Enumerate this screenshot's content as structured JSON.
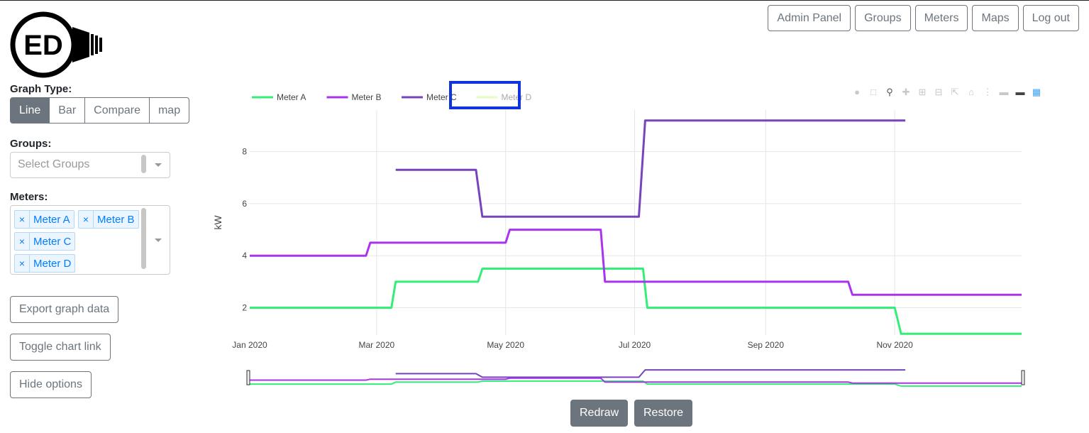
{
  "logo": {
    "text": "ED"
  },
  "nav": {
    "admin": "Admin Panel",
    "groups": "Groups",
    "meters": "Meters",
    "maps": "Maps",
    "logout": "Log out"
  },
  "options": {
    "graph_type_label": "Graph Type:",
    "graph_types": [
      "Line",
      "Bar",
      "Compare",
      "map"
    ],
    "active_graph_type": "Line",
    "groups_label": "Groups:",
    "groups_placeholder": "Select Groups",
    "meters_label": "Meters:",
    "selected_meters": [
      "Meter A",
      "Meter B",
      "Meter C",
      "Meter D"
    ],
    "chip_remove": "×",
    "export": "Export graph data",
    "toggle_link": "Toggle chart link",
    "hide": "Hide options"
  },
  "footer": {
    "redraw": "Redraw",
    "restore": "Restore"
  },
  "modebar_icons": [
    "camera-icon",
    "save-icon",
    "zoom-icon",
    "pan-icon",
    "zoom-in-icon",
    "zoom-out-icon",
    "autoscale-icon",
    "reset-axes-icon",
    "spike-lines-icon",
    "hover-closest-icon",
    "hover-compare-icon",
    "plotly-logo-icon"
  ],
  "chart_data": {
    "type": "line",
    "ylabel": "kW",
    "xlabel": "",
    "ylim": [
      0.95,
      9.6
    ],
    "xlim": [
      "2020-01-01",
      "2020-12-31"
    ],
    "y_ticks": [
      "2",
      "4",
      "6",
      "8"
    ],
    "x_ticks": [
      {
        "date": "2020-01-01",
        "label": "Jan 2020"
      },
      {
        "date": "2020-03-01",
        "label": "Mar 2020"
      },
      {
        "date": "2020-05-01",
        "label": "May 2020"
      },
      {
        "date": "2020-07-01",
        "label": "Jul 2020"
      },
      {
        "date": "2020-09-01",
        "label": "Sep 2020"
      },
      {
        "date": "2020-11-01",
        "label": "Nov 2020"
      }
    ],
    "grid": true,
    "legend_position": "top-left",
    "range_slider": true,
    "series": [
      {
        "name": "Meter A",
        "color": "#33ee77",
        "hidden": false,
        "points": [
          [
            "2020-01-01",
            2
          ],
          [
            "2020-03-08",
            2
          ],
          [
            "2020-03-10",
            3
          ],
          [
            "2020-04-18",
            3
          ],
          [
            "2020-04-20",
            3.5
          ],
          [
            "2020-07-05",
            3.5
          ],
          [
            "2020-07-07",
            2
          ],
          [
            "2020-11-01",
            2
          ],
          [
            "2020-11-04",
            1
          ],
          [
            "2020-12-31",
            1
          ]
        ]
      },
      {
        "name": "Meter B",
        "color": "#aa33ee",
        "hidden": false,
        "points": [
          [
            "2020-01-01",
            4
          ],
          [
            "2020-02-25",
            4
          ],
          [
            "2020-02-27",
            4.5
          ],
          [
            "2020-05-01",
            4.5
          ],
          [
            "2020-05-03",
            5
          ],
          [
            "2020-06-15",
            5
          ],
          [
            "2020-06-17",
            3
          ],
          [
            "2020-10-10",
            3
          ],
          [
            "2020-10-12",
            2.5
          ],
          [
            "2020-12-31",
            2.5
          ]
        ]
      },
      {
        "name": "Meter C",
        "color": "#7744bb",
        "hidden": false,
        "points": [
          [
            "2020-03-10",
            7.3
          ],
          [
            "2020-04-17",
            7.3
          ],
          [
            "2020-04-20",
            5.5
          ],
          [
            "2020-07-03",
            5.5
          ],
          [
            "2020-07-06",
            9.2
          ],
          [
            "2020-11-06",
            9.2
          ]
        ]
      },
      {
        "name": "Meter D",
        "color": "#ccff99",
        "hidden": true,
        "points": []
      }
    ]
  }
}
